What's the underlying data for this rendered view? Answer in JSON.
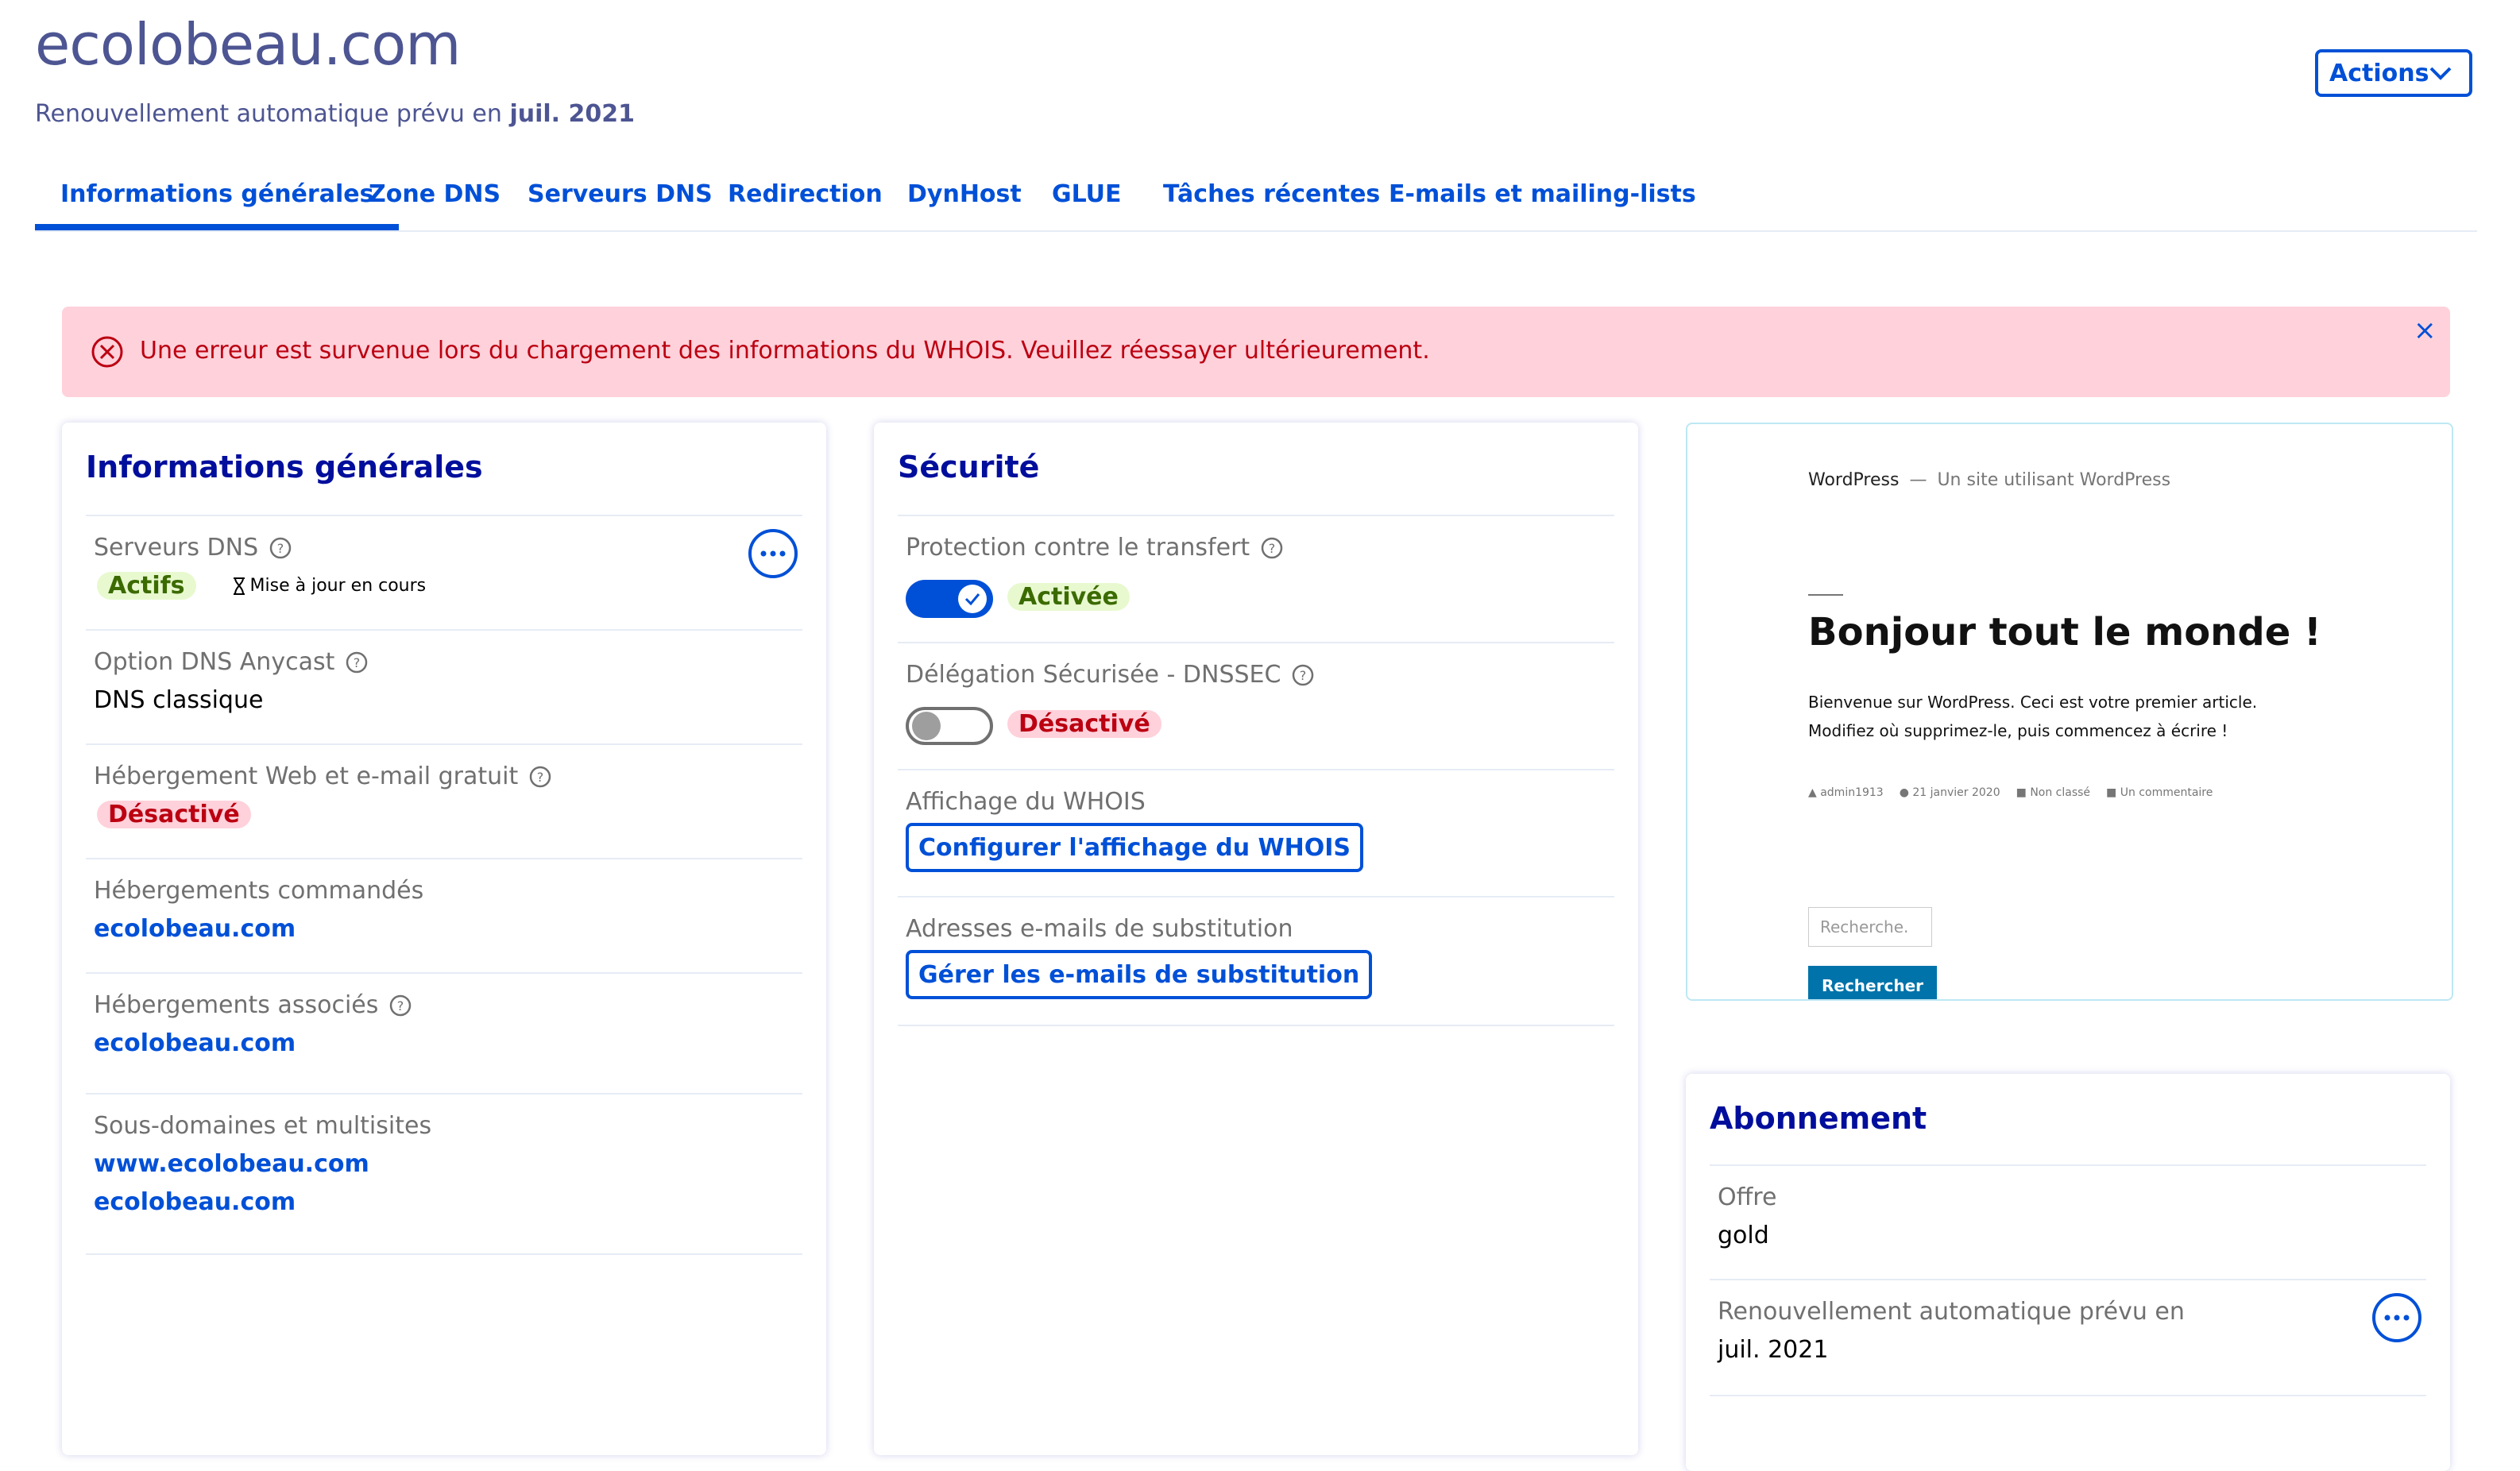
{
  "header": {
    "title": "ecolobeau.com",
    "renewal_prefix": "Renouvellement automatique prévu en",
    "renewal_date": "juil. 2021",
    "actions_label": "Actions"
  },
  "tabs": [
    {
      "label": "Informations générales",
      "active": true
    },
    {
      "label": "Zone DNS"
    },
    {
      "label": "Serveurs DNS"
    },
    {
      "label": "Redirection"
    },
    {
      "label": "DynHost"
    },
    {
      "label": "GLUE"
    },
    {
      "label": "Tâches récentes"
    },
    {
      "label": "E-mails et mailing-lists"
    }
  ],
  "alert": {
    "message": "Une erreur est survenue lors du chargement des informations du WHOIS. Veuillez réessayer ultérieurement.",
    "close": "×"
  },
  "general": {
    "title": "Informations générales",
    "dns_servers_label": "Serveurs DNS",
    "dns_servers_status": "Actifs",
    "dns_servers_update": "Mise à jour en cours",
    "anycast_label": "Option DNS Anycast",
    "anycast_value": "DNS classique",
    "free_hosting_label": "Hébergement Web et e-mail gratuit",
    "free_hosting_status": "Désactivé",
    "ordered_hosting_label": "Hébergements commandés",
    "ordered_hosting_value": "ecolobeau.com",
    "assoc_hosting_label": "Hébergements associés",
    "assoc_hosting_value": "ecolobeau.com",
    "subdomains_label": "Sous-domaines et multisites",
    "subdomains": [
      "www.ecolobeau.com",
      "ecolobeau.com"
    ]
  },
  "security": {
    "title": "Sécurité",
    "transfer_label": "Protection contre le transfert",
    "transfer_status": "Activée",
    "dnssec_label": "Délégation Sécurisée - DNSSEC",
    "dnssec_status": "Désactivé",
    "whois_label": "Affichage du WHOIS",
    "whois_button": "Configurer l'affichage du WHOIS",
    "emails_label": "Adresses e-mails de substitution",
    "emails_button": "Gérer les e-mails de substitution"
  },
  "preview": {
    "site_name": "WordPress",
    "dash": "—",
    "tagline": "Un site utilisant WordPress",
    "post_title": "Bonjour tout le monde !",
    "post_line1": "Bienvenue sur WordPress. Ceci est votre premier article.",
    "post_line2": "Modifiez où supprimez-le, puis commencez à écrire !",
    "meta_author": "admin1913",
    "meta_date": "21 janvier 2020",
    "meta_category": "Non classé",
    "meta_comment": "Un commentaire",
    "search_placeholder": "Recherche.",
    "search_button": "Rechercher"
  },
  "subscription": {
    "title": "Abonnement",
    "offer_label": "Offre",
    "offer_value": "gold",
    "renewal_label": "Renouvellement automatique prévu en",
    "renewal_value": "juil. 2021"
  },
  "colors": {
    "primary": "#0050d7",
    "title_dark": "#000e9c",
    "success_bg": "#e8f9cf",
    "error_bg": "#ffd1db",
    "error_text": "#bb0011"
  }
}
